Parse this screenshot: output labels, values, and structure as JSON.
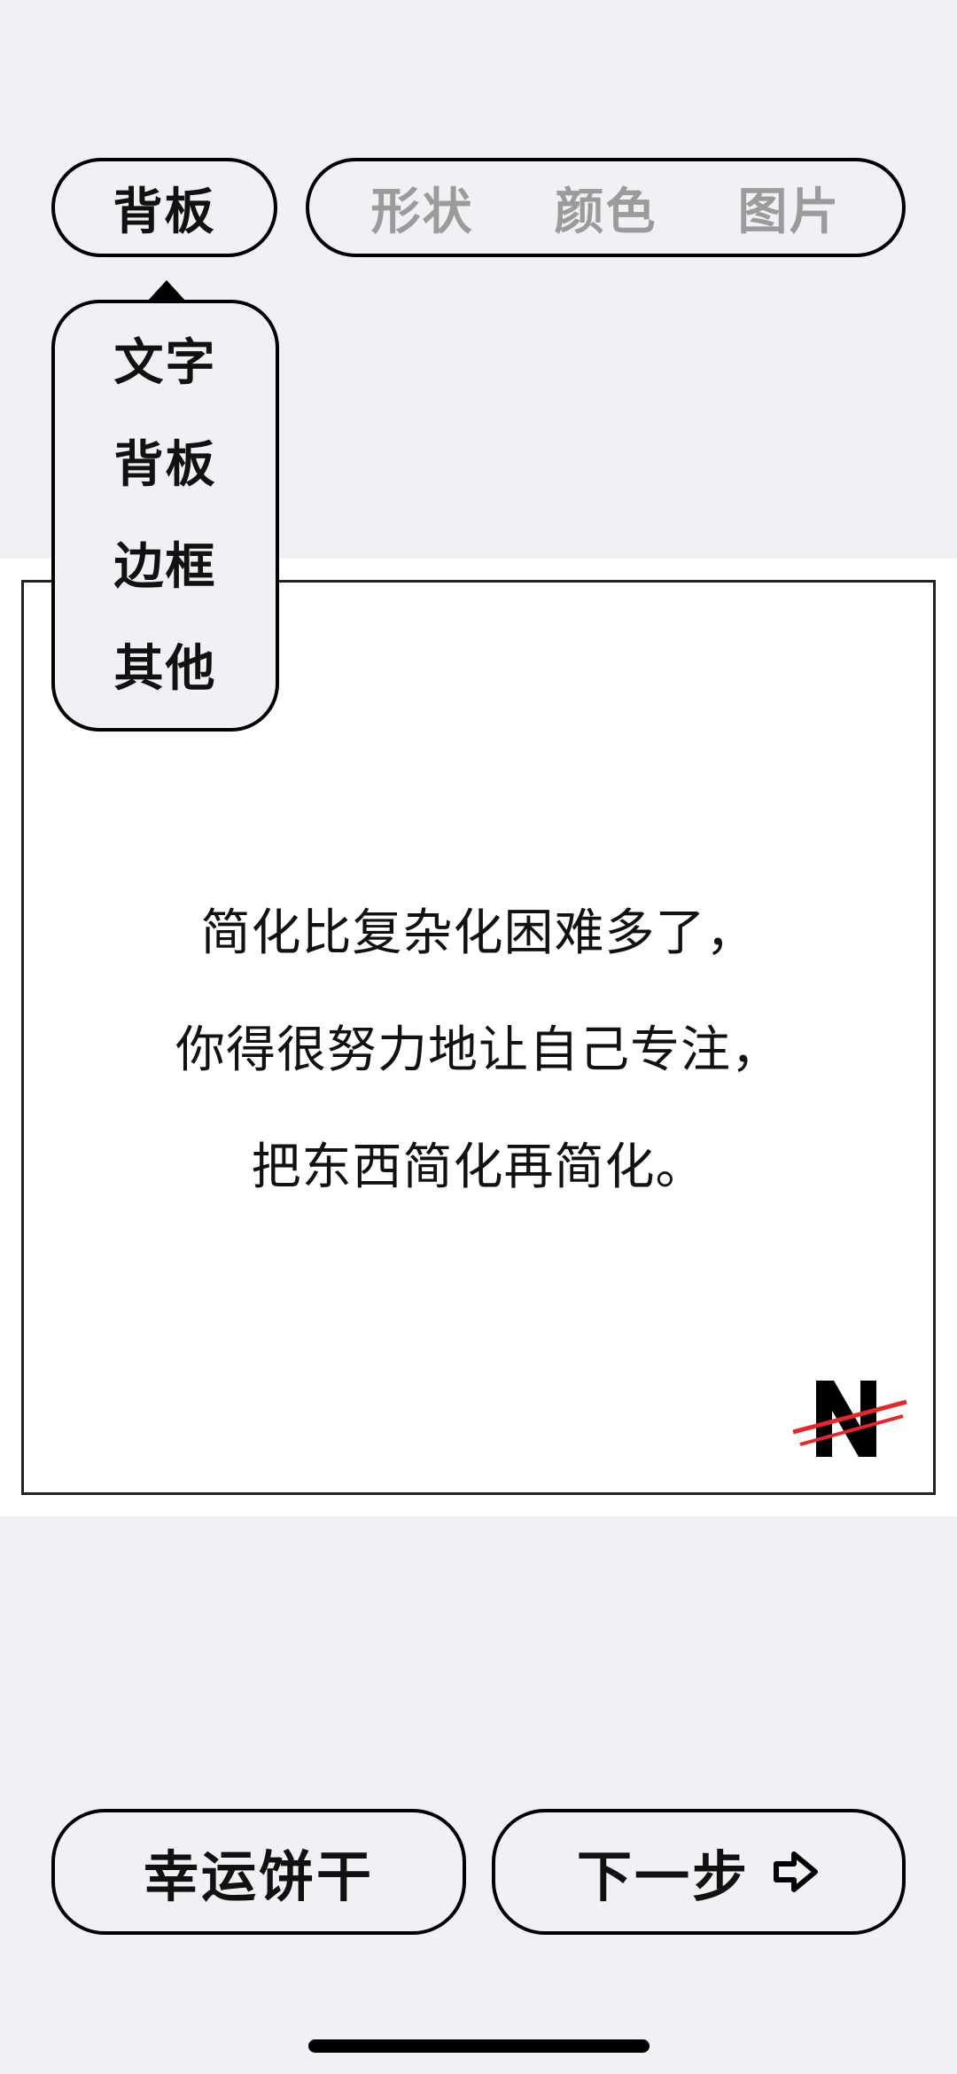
{
  "top_bar": {
    "selected_category": "背板",
    "options": [
      "形状",
      "颜色",
      "图片"
    ]
  },
  "dropdown": {
    "items": [
      "文字",
      "背板",
      "边框",
      "其他"
    ]
  },
  "canvas": {
    "quote_lines": [
      "简化比复杂化困难多了，",
      "你得很努力地让自己专注，",
      "把东西简化再简化。"
    ],
    "logo_icon": "n-logo-icon",
    "logo_letter": "N",
    "logo_accent_color": "#e8262a"
  },
  "bottom": {
    "left_button": "幸运饼干",
    "right_button": "下一步",
    "right_button_icon": "arrow-right-icon"
  }
}
